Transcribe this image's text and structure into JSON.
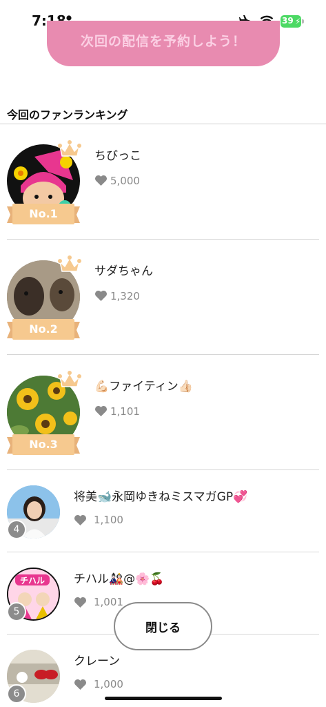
{
  "status": {
    "time": "7:18",
    "battery": "39"
  },
  "reserve_button": "次回の配信を予約しよう！",
  "section_title": "今回のファンランキング",
  "top_ranks": [
    {
      "name": "ちびっこ",
      "likes": "5,000",
      "badge": "No.1"
    },
    {
      "name": "サダちゃん",
      "likes": "1,320",
      "badge": "No.2"
    },
    {
      "name": "💪🏻ファイティン👍🏻",
      "likes": "1,101",
      "badge": "No.3"
    }
  ],
  "other_ranks": [
    {
      "rank": "4",
      "name": "将美🐋永岡ゆきねミスマガGP💞",
      "likes": "1,100"
    },
    {
      "rank": "5",
      "name": "チハル🎎@🌸🍒",
      "likes": "1,001"
    },
    {
      "rank": "6",
      "name": "クレーン",
      "likes": "1,000"
    }
  ],
  "avatar5_text": "チハル",
  "close_button": "閉じる",
  "colors": {
    "accent_pink": "#e88bb0",
    "ribbon": "#f6c98f",
    "crown": "#f6c98f",
    "battery": "#4cd964"
  }
}
